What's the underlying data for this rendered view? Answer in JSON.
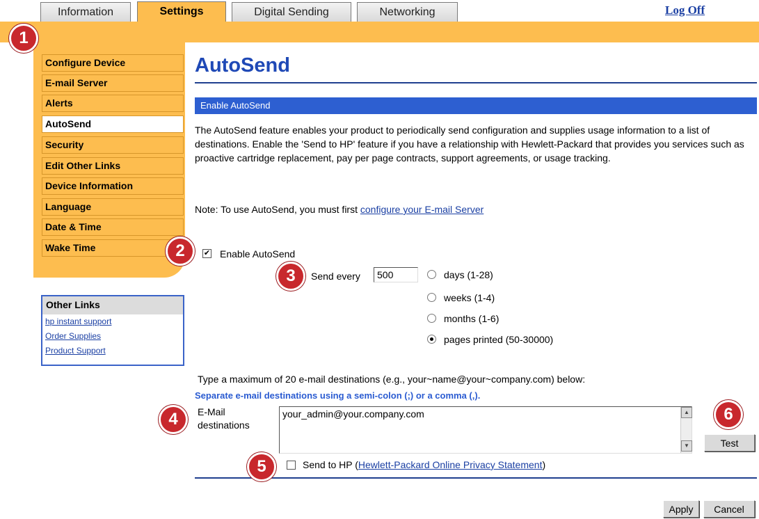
{
  "tabs": [
    {
      "label": "Information",
      "active": false
    },
    {
      "label": "Settings",
      "active": true
    },
    {
      "label": "Digital Sending",
      "active": false
    },
    {
      "label": "Networking",
      "active": false
    }
  ],
  "log_off": "Log Off",
  "sidebar": {
    "items": [
      {
        "label": "Configure Device"
      },
      {
        "label": "E-mail Server"
      },
      {
        "label": "Alerts"
      },
      {
        "label": "AutoSend",
        "selected": true
      },
      {
        "label": "Security"
      },
      {
        "label": "Edit Other Links"
      },
      {
        "label": "Device Information"
      },
      {
        "label": "Language"
      },
      {
        "label": "Date & Time"
      },
      {
        "label": "Wake Time"
      }
    ]
  },
  "other_links": {
    "title": "Other Links",
    "links": [
      "hp instant support",
      "Order Supplies",
      "Product Support"
    ]
  },
  "main": {
    "title": "AutoSend",
    "section": "Enable AutoSend",
    "description": "The AutoSend feature enables your product to periodically send configuration and supplies usage information to a list of destinations. Enable the 'Send to HP' feature if you have a relationship with Hewlett-Packard that provides you services such as proactive cartridge replacement, pay per page contracts, support agreements, or usage tracking.",
    "note_prefix": "Note: To use AutoSend, you must first ",
    "note_link": "configure your E-mail Server",
    "enable_label": "Enable AutoSend",
    "enable_checked": true,
    "send_every_label": "Send every",
    "send_every_value": "500",
    "interval_options": [
      {
        "label": "days (1-28)",
        "checked": false
      },
      {
        "label": "weeks (1-4)",
        "checked": false
      },
      {
        "label": "months (1-6)",
        "checked": false
      },
      {
        "label": "pages printed (50-30000)",
        "checked": true
      }
    ],
    "max_dest_text": "Type a maximum of 20 e-mail destinations (e.g., your~name@your~company.com) below:",
    "separator_hint": "Separate e-mail destinations using a semi-colon (;) or a comma (,).",
    "email_label_line1": "E-Mail",
    "email_label_line2": "destinations",
    "email_value": "your_admin@your.company.com",
    "test_button": "Test",
    "send_to_hp_label": "Send to HP (",
    "privacy_link": "Hewlett-Packard Online Privacy Statement",
    "send_to_hp_close": ")",
    "send_to_hp_checked": false,
    "apply_button": "Apply",
    "cancel_button": "Cancel"
  },
  "callouts": [
    "1",
    "2",
    "3",
    "4",
    "5",
    "6"
  ],
  "colors": {
    "tab_orange": "#fdbd4f",
    "title_blue": "#1f49b6",
    "section_blue": "#2d5fd1",
    "callout_red": "#c8282d"
  }
}
